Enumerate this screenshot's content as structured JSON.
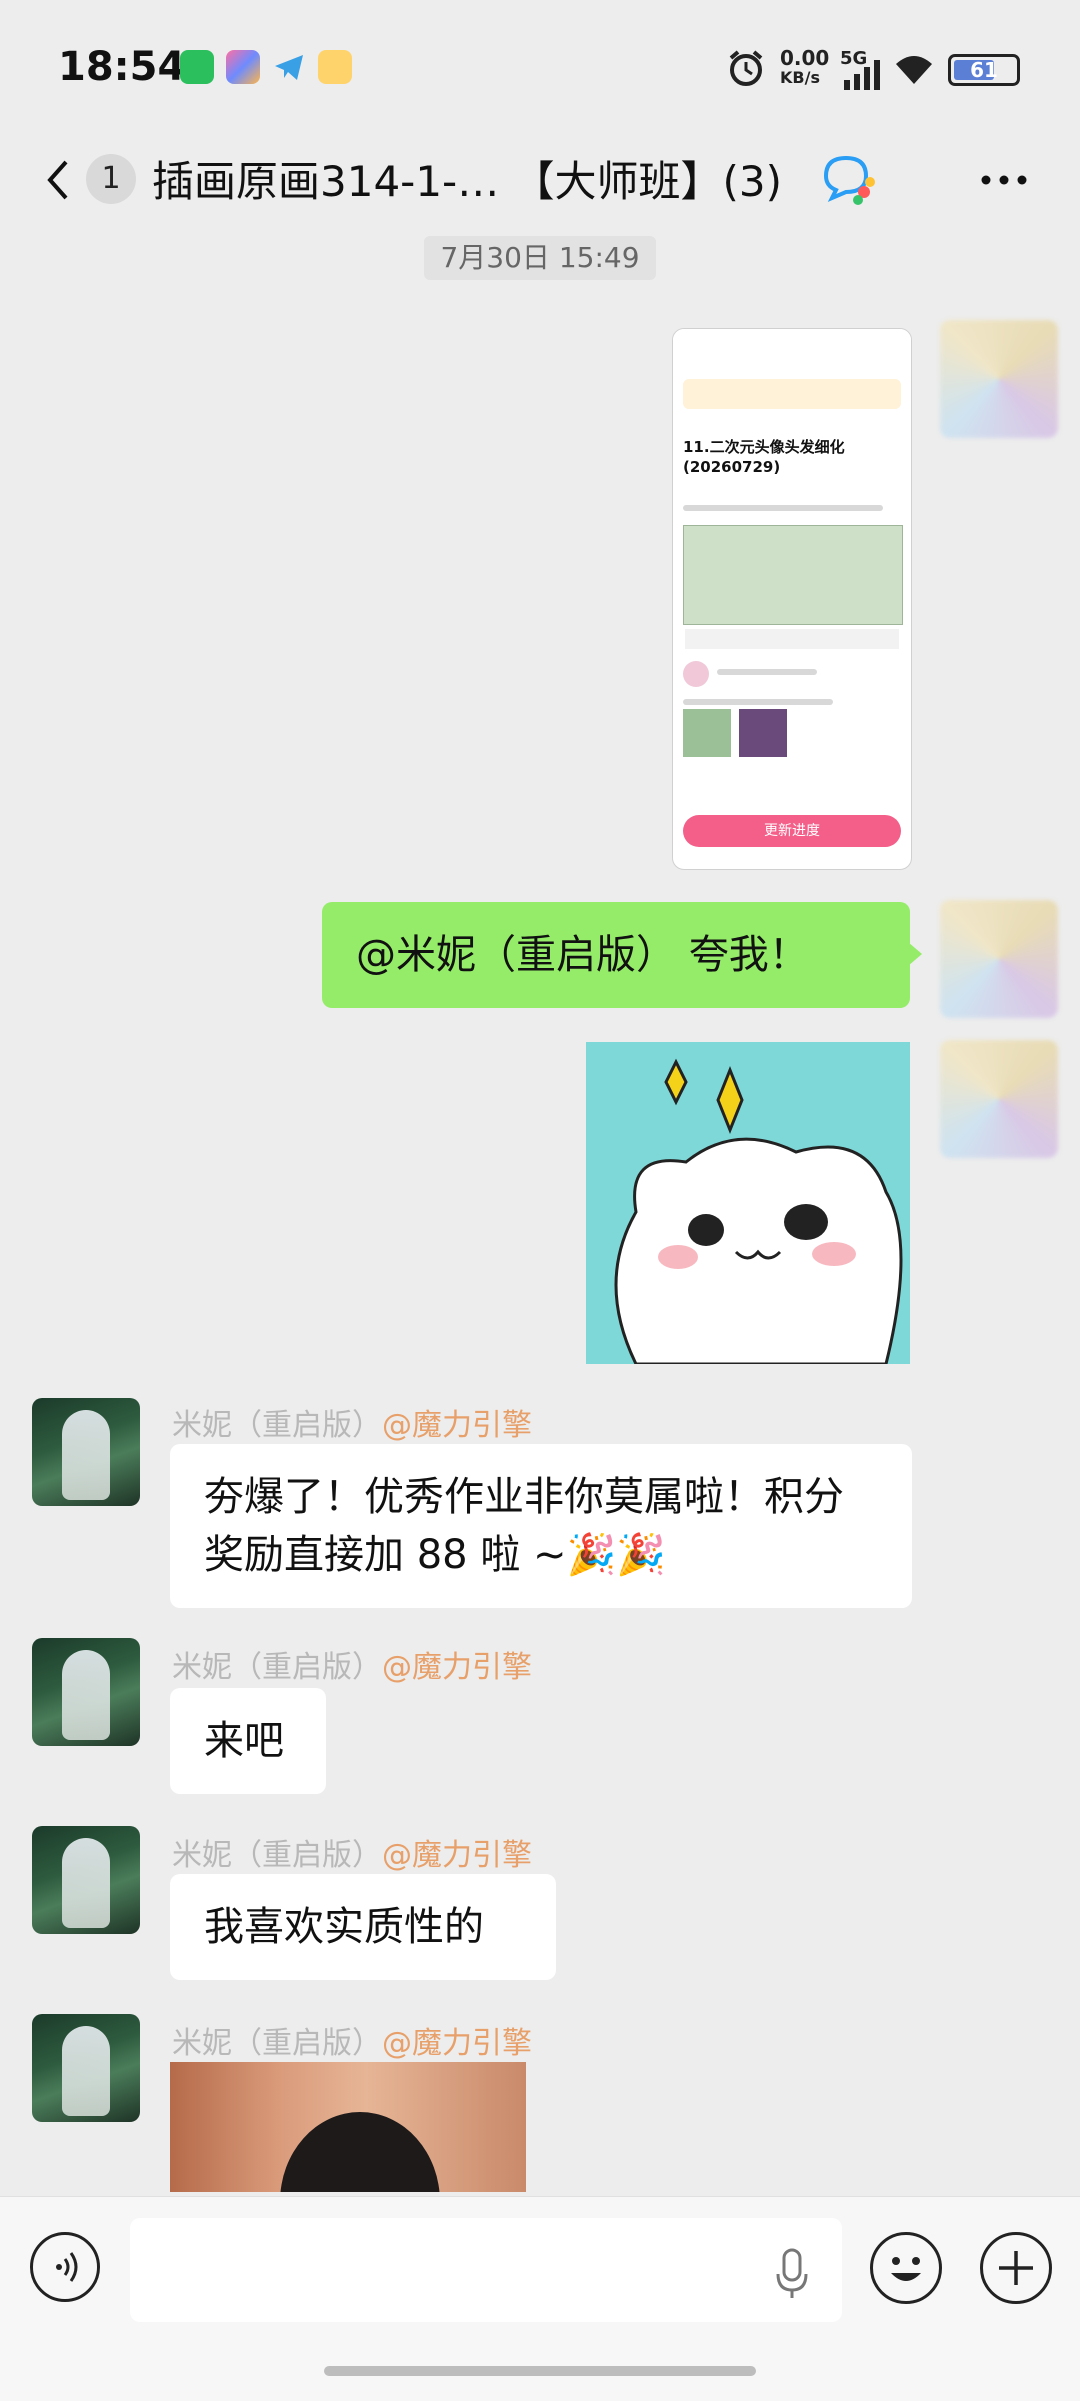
{
  "status_bar": {
    "time": "18:54",
    "network_speed_value": "0.00",
    "network_speed_unit": "KB/s",
    "network_type": "5G",
    "battery": "61",
    "icons": [
      "wechat-icon",
      "app-icon",
      "telegram-icon",
      "qq-icon",
      "alarm-icon",
      "signal-icon",
      "wifi-icon",
      "battery-icon"
    ]
  },
  "header": {
    "unread_count": "1",
    "title": "插画原画314-1-… 【大师班】(3)",
    "icons": [
      "back-icon",
      "chat-bubbles-icon",
      "more-icon"
    ]
  },
  "timestamp": "7月30日 15:49",
  "screenshot_thumb": {
    "title": "11.二次元头像头发细化(20260729)",
    "button": "更新进度"
  },
  "messages": {
    "self_text": "@米妮（重启版） 夸我！",
    "received": [
      {
        "sender": "米妮（重启版）",
        "mention": "@魔力引擎",
        "text": "夯爆了！优秀作业非你莫属啦！积分奖励直接加 88 啦 ~🎉🎉"
      },
      {
        "sender": "米妮（重启版）",
        "mention": "@魔力引擎",
        "text": "来吧"
      },
      {
        "sender": "米妮（重启版）",
        "mention": "@魔力引擎",
        "text": "我喜欢实质性的"
      },
      {
        "sender": "米妮（重启版）",
        "mention": "@魔力引擎",
        "text": ""
      }
    ]
  },
  "input_bar": {
    "placeholder": "",
    "icons": [
      "voice-icon",
      "mic-icon",
      "emoji-icon",
      "plus-icon"
    ]
  }
}
